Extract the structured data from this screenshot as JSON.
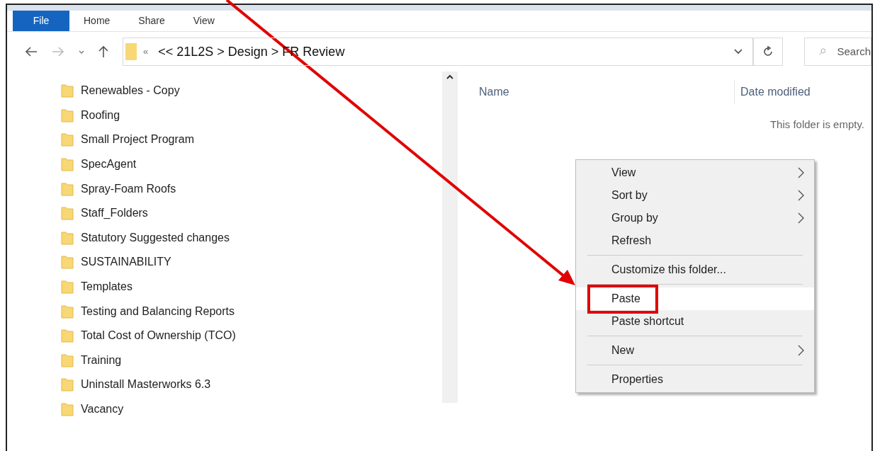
{
  "ribbon_tabs": [
    {
      "label": "File",
      "selected": true
    },
    {
      "label": "Home",
      "selected": false
    },
    {
      "label": "Share",
      "selected": false
    },
    {
      "label": "View",
      "selected": false
    }
  ],
  "address_bar": {
    "overflow": "«",
    "path": "<< 21L2S > Design > FR Review"
  },
  "search": {
    "placeholder": "Search"
  },
  "nav_pane": {
    "items": [
      "Renewables - Copy",
      "Roofing",
      "Small Project Program",
      "SpecAgent",
      "Spray-Foam Roofs",
      "Staff_Folders",
      "Statutory Suggested changes",
      "SUSTAINABILITY",
      "Templates",
      "Testing and Balancing Reports",
      "Total Cost of Ownership (TCO)",
      "Training",
      "Uninstall Masterworks 6.3",
      "Vacancy"
    ]
  },
  "columns": [
    "Name",
    "Date modified"
  ],
  "empty_message": "This folder is empty.",
  "context_menu": {
    "groups": [
      [
        {
          "label": "View",
          "submenu": true,
          "selected": false
        },
        {
          "label": "Sort by",
          "submenu": true,
          "selected": false
        },
        {
          "label": "Group by",
          "submenu": true,
          "selected": false
        },
        {
          "label": "Refresh",
          "submenu": false,
          "selected": false
        }
      ],
      [
        {
          "label": "Customize this folder...",
          "submenu": false,
          "selected": false
        }
      ],
      [
        {
          "label": "Paste",
          "submenu": false,
          "selected": true
        },
        {
          "label": "Paste shortcut",
          "submenu": false,
          "selected": false
        }
      ],
      [
        {
          "label": "New",
          "submenu": true,
          "selected": false
        }
      ],
      [
        {
          "label": "Properties",
          "submenu": false,
          "selected": false
        }
      ]
    ]
  }
}
